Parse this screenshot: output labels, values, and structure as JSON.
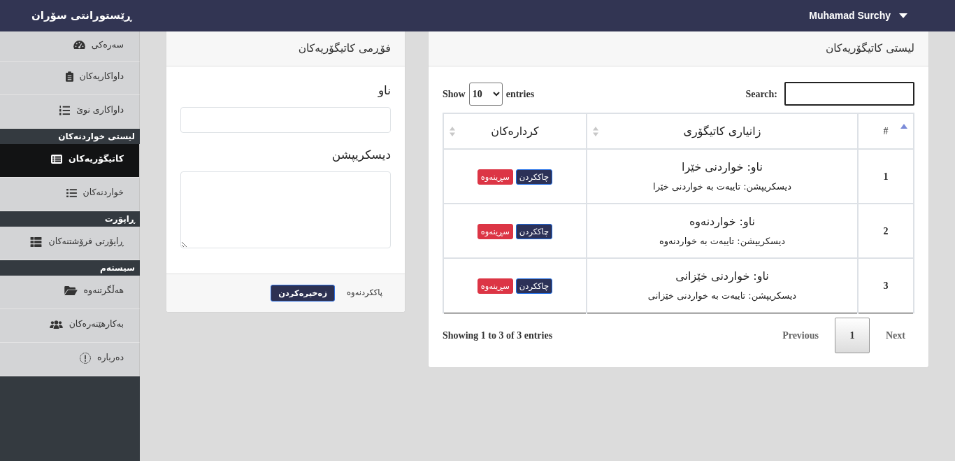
{
  "navbar": {
    "brand": "ڕێستورانتی سۆران",
    "user": "Muhamad Surchy"
  },
  "sidebar": {
    "items": [
      {
        "kind": "link",
        "label": "سەرەکی",
        "selected": false
      },
      {
        "kind": "link",
        "label": "داواکاریەکان",
        "selected": false
      },
      {
        "kind": "link",
        "label": "داواکاری نوێ",
        "selected": false
      },
      {
        "kind": "section",
        "label": "لیستی خواردنەکان"
      },
      {
        "kind": "link",
        "label": "کاتیگۆریەکان",
        "selected": true
      },
      {
        "kind": "link",
        "label": "خواردنەکان",
        "selected": false
      },
      {
        "kind": "section",
        "label": "ڕاپۆرت"
      },
      {
        "kind": "link",
        "label": "ڕاپۆرتی فرۆشتنەکان",
        "selected": false
      },
      {
        "kind": "section",
        "label": "سیستەم"
      },
      {
        "kind": "link",
        "label": "هەڵگرتنەوە",
        "selected": false
      },
      {
        "kind": "link",
        "label": "بەکارهێنەرەکان",
        "selected": false
      },
      {
        "kind": "link",
        "label": "دەربارە",
        "selected": false
      }
    ]
  },
  "category_list": {
    "title": "لیستی کاتیگۆریەکان",
    "length_menu": {
      "before": "Show",
      "value": "10",
      "after": "entries"
    },
    "search": {
      "label": "Search:"
    },
    "columns": [
      {
        "label": "#",
        "sorted": true
      },
      {
        "label": "زانیاری کاتیگۆری",
        "sorted": false
      },
      {
        "label": "کردارەکان",
        "sorted": false
      }
    ],
    "rows": [
      {
        "number": "1",
        "name": "ناو: خواردنی خێرا",
        "description": "دیسکریپشن: تایبەت بە خواردنی خێرا",
        "actions": [
          {
            "kind": "edit",
            "label": "چاککردن"
          },
          {
            "kind": "delete",
            "label": "سڕینەوە"
          }
        ]
      },
      {
        "number": "2",
        "name": "ناو: خواردنەوە",
        "description": "دیسکریپشن: تایبەت بە خواردنەوە",
        "actions": [
          {
            "kind": "edit",
            "label": "چاککردن"
          },
          {
            "kind": "delete",
            "label": "سڕینەوە"
          }
        ]
      },
      {
        "number": "3",
        "name": "ناو: خواردنی خێزانی",
        "description": "دیسکریپشن: تایبەت بە خواردنی خێزانی",
        "actions": [
          {
            "kind": "edit",
            "label": "چاککردن"
          },
          {
            "kind": "delete",
            "label": "سڕینەوە"
          }
        ]
      }
    ],
    "info": "Showing 1 to 3 of 3 entries",
    "pagination": [
      {
        "kind": "next",
        "label": "Next",
        "selected": false,
        "disabled": true
      },
      {
        "kind": "page",
        "label": "1",
        "selected": true,
        "disabled": false
      },
      {
        "kind": "previous",
        "label": "Previous",
        "selected": false,
        "disabled": true
      }
    ]
  },
  "category_form": {
    "title": "فۆڕمی کاتیگۆریەکان",
    "fields": [
      {
        "kind": "input",
        "label": "ناو"
      },
      {
        "kind": "textarea",
        "label": "دیسکریپشن"
      }
    ],
    "buttons": [
      {
        "kind": "reset",
        "label": "پاککردنەوە"
      },
      {
        "kind": "submit",
        "label": "زەخیرەکردن"
      }
    ]
  }
}
